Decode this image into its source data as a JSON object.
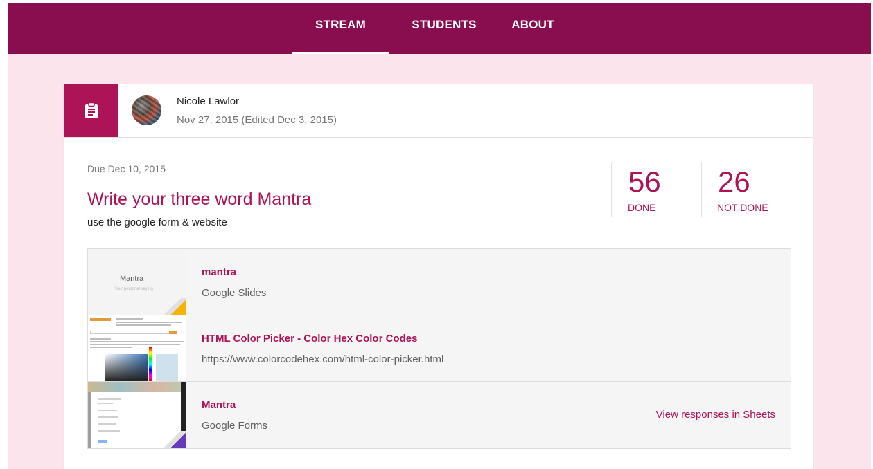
{
  "nav": {
    "tabs": [
      {
        "label": "STREAM",
        "active": true
      },
      {
        "label": "STUDENTS",
        "active": false
      },
      {
        "label": "ABOUT",
        "active": false
      }
    ]
  },
  "post": {
    "type_icon": "assignment-icon",
    "author": "Nicole Lawlor",
    "posted": "Nov 27, 2015 (Edited Dec 3, 2015)",
    "due": "Due Dec 10, 2015",
    "title": "Write your three word Mantra",
    "description": "use the google form & website",
    "stats": {
      "done": {
        "count": "56",
        "label": "DONE"
      },
      "not_done": {
        "count": "26",
        "label": "NOT DONE"
      }
    },
    "attachments": [
      {
        "title": "mantra",
        "subtitle": "Google Slides",
        "thumb_text": "Mantra",
        "thumb_subtext": "Your personal saying"
      },
      {
        "title": "HTML Color Picker - Color Hex Color Codes",
        "subtitle": "https://www.colorcodehex.com/html-color-picker.html"
      },
      {
        "title": "Mantra",
        "subtitle": "Google Forms",
        "action": "View responses in Sheets"
      }
    ]
  },
  "colors": {
    "header": "#880e4f",
    "accent": "#ad1457",
    "background": "#fce4ec"
  }
}
